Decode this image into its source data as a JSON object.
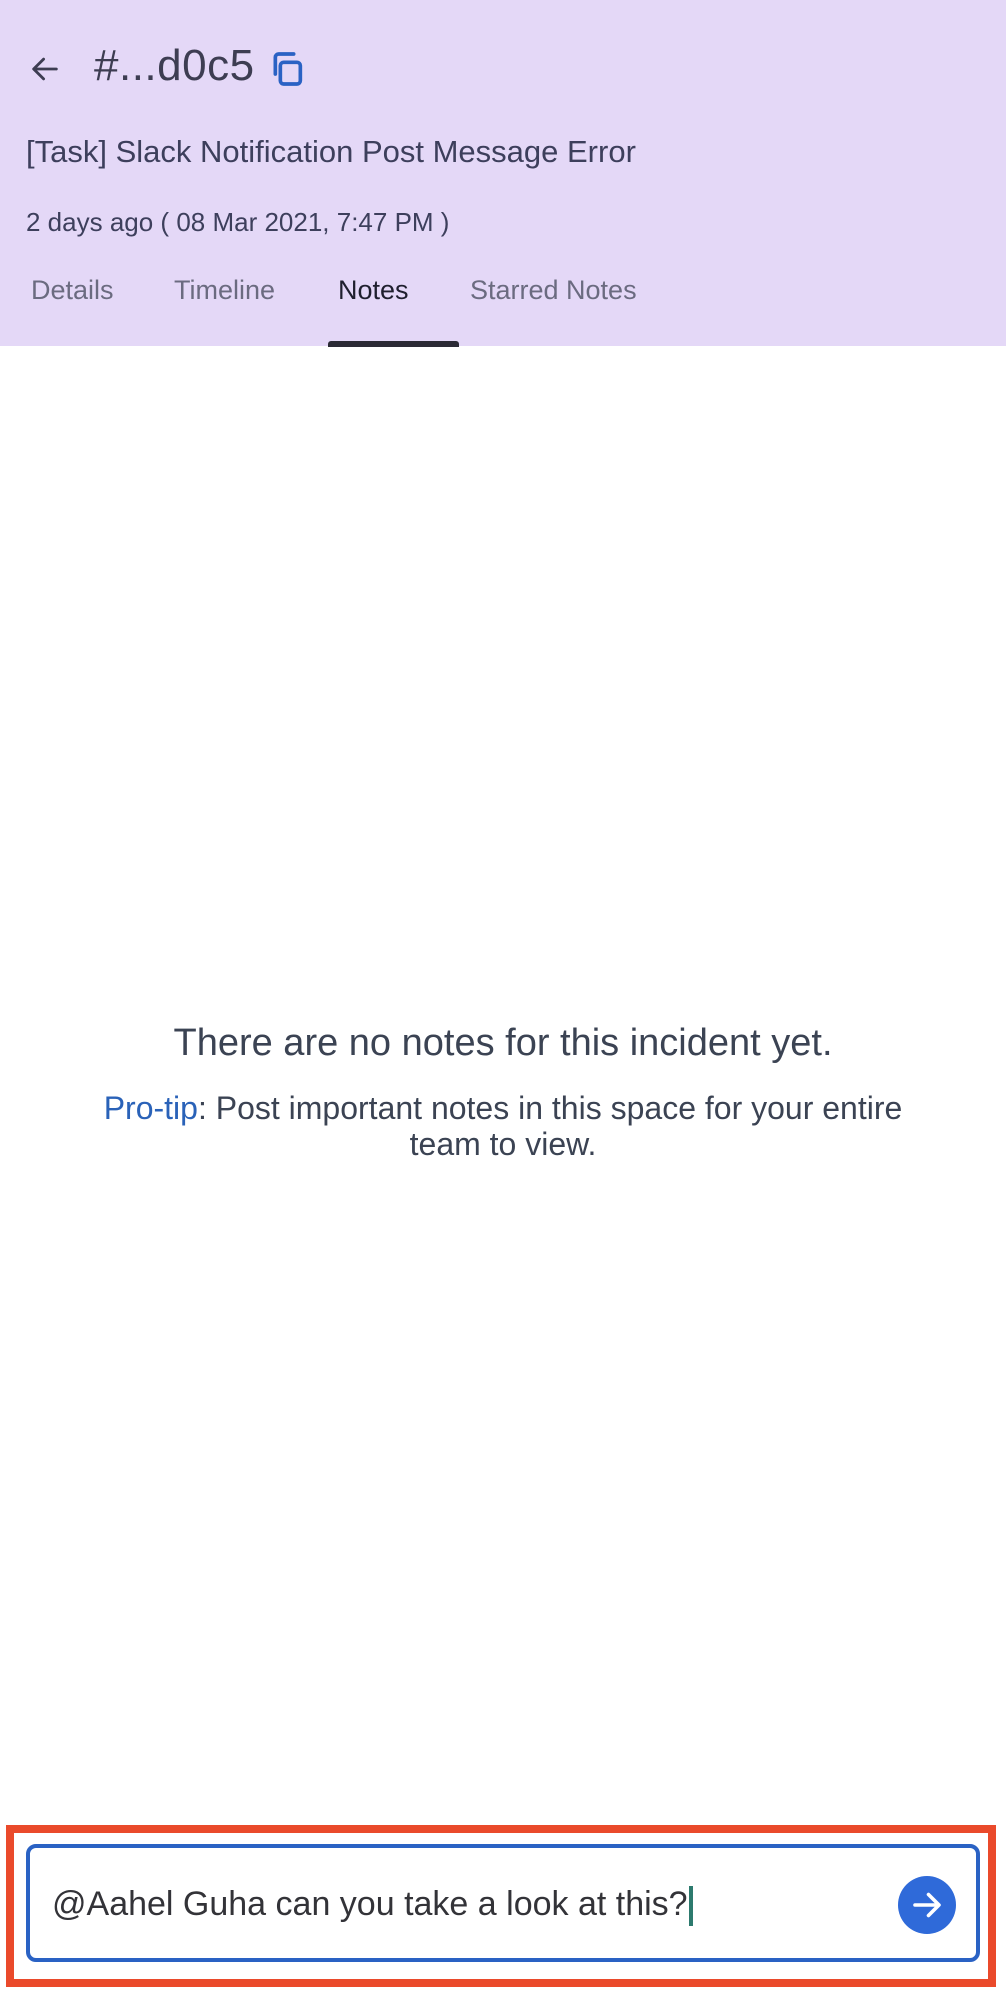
{
  "header": {
    "back_icon": "arrow-left-icon",
    "incident_id": "#...d0c5",
    "copy_icon": "copy-icon",
    "title": "[Task] Slack Notification Post Message Error",
    "time": "2 days ago ( 08 Mar 2021, 7:47 PM )",
    "background_color": "#e4d8f7"
  },
  "tabs": [
    {
      "label": "Details",
      "active": false
    },
    {
      "label": "Timeline",
      "active": false
    },
    {
      "label": "Notes",
      "active": true
    },
    {
      "label": "Starred Notes",
      "active": false
    }
  ],
  "empty_state": {
    "title": "There are no notes for this incident yet.",
    "tip_label": "Pro-tip",
    "tip_text": ": Post important notes in this space for your entire team to view."
  },
  "composer": {
    "value": "@Aahel Guha can you take a look at this?",
    "send_icon": "arrow-right-icon",
    "accent_color": "#2f6ad9",
    "highlight_color": "#ea4a2b"
  }
}
